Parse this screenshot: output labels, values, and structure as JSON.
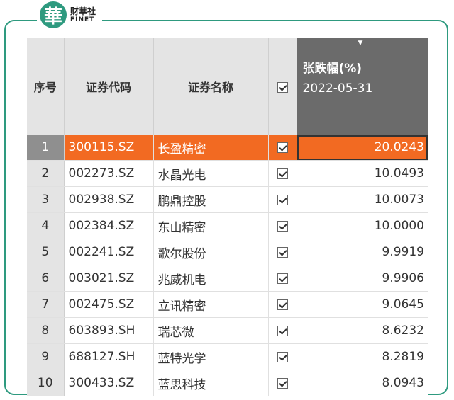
{
  "brand": {
    "logo_char": "華",
    "name_cn": "财華社",
    "name_en": "FINET",
    "accent_color": "#2e9a7f"
  },
  "table": {
    "headers": {
      "index": "序号",
      "code": "证券代码",
      "name": "证券名称",
      "change_title": "张跌幅(%)",
      "change_date": "2022-05-31"
    },
    "selected_row": 1,
    "rows": [
      {
        "index": "1",
        "code": "300115.SZ",
        "name": "长盈精密",
        "checked": true,
        "value": "20.0243"
      },
      {
        "index": "2",
        "code": "002273.SZ",
        "name": "水晶光电",
        "checked": true,
        "value": "10.0493"
      },
      {
        "index": "3",
        "code": "002938.SZ",
        "name": "鹏鼎控股",
        "checked": true,
        "value": "10.0073"
      },
      {
        "index": "4",
        "code": "002384.SZ",
        "name": "东山精密",
        "checked": true,
        "value": "10.0000"
      },
      {
        "index": "5",
        "code": "002241.SZ",
        "name": "歌尔股份",
        "checked": true,
        "value": "9.9919"
      },
      {
        "index": "6",
        "code": "003021.SZ",
        "name": "兆威机电",
        "checked": true,
        "value": "9.9906"
      },
      {
        "index": "7",
        "code": "002475.SZ",
        "name": "立讯精密",
        "checked": true,
        "value": "9.0645"
      },
      {
        "index": "8",
        "code": "603893.SH",
        "name": "瑞芯微",
        "checked": true,
        "value": "8.6232"
      },
      {
        "index": "9",
        "code": "688127.SH",
        "name": "蓝特光学",
        "checked": true,
        "value": "8.2819"
      },
      {
        "index": "10",
        "code": "300433.SZ",
        "name": "蓝思科技",
        "checked": true,
        "value": "8.0943"
      }
    ],
    "selected_color": "#f26a22",
    "header_dark_color": "#6b6b6b"
  }
}
